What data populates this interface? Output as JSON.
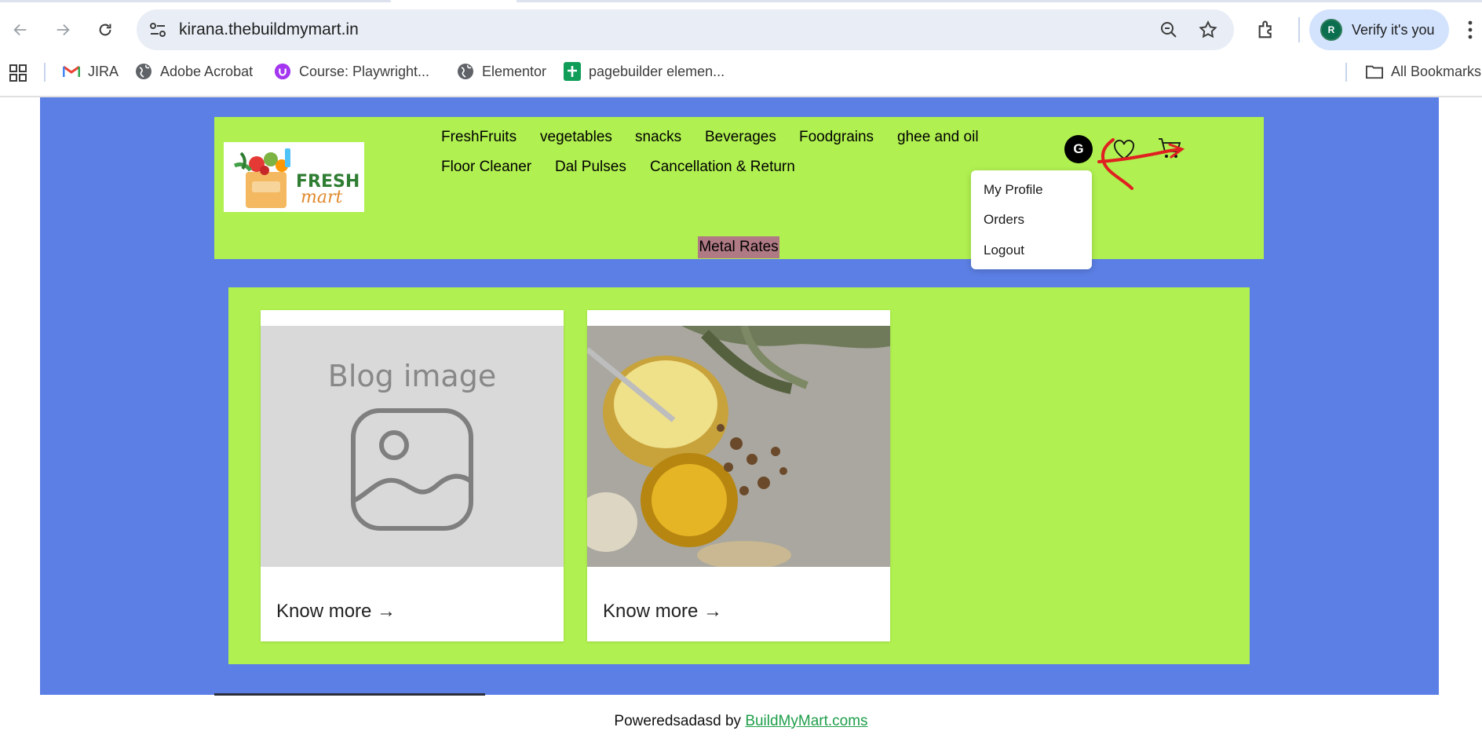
{
  "browser": {
    "url": "kirana.thebuildmymart.in",
    "verify_label": "Verify it's you",
    "profile_initial": "R",
    "bookmarks": [
      {
        "label": "JIRA",
        "icon": "gmail-icon"
      },
      {
        "label": "Adobe Acrobat",
        "icon": "globe-icon"
      },
      {
        "label": "Course: Playwright...",
        "icon": "udemy-icon"
      },
      {
        "label": "Elementor",
        "icon": "globe-icon"
      },
      {
        "label": "pagebuilder elemen...",
        "icon": "sheets-icon"
      }
    ],
    "all_bookmarks_label": "All Bookmarks"
  },
  "site": {
    "logo_text_top": "FRESH",
    "logo_text_bottom": "mart",
    "nav": [
      "FreshFruits",
      "vegetables",
      "snacks",
      "Beverages",
      "Foodgrains",
      "ghee and oil",
      "Floor Cleaner",
      "Dal Pulses",
      "Cancellation & Return"
    ],
    "metal_rates": "Metal Rates",
    "user_initial": "G",
    "dropdown": [
      "My Profile",
      "Orders",
      "Logout"
    ]
  },
  "cards": [
    {
      "placeholder_text": "Blog image",
      "link": "Know more →"
    },
    {
      "placeholder_text": "",
      "link": "Know more →"
    }
  ],
  "footer": {
    "prefix": "Poweredsadasd by ",
    "link": "BuildMyMart.coms"
  },
  "colors": {
    "page_bg": "#5b7fe4",
    "header_bg": "#b0f050",
    "metal_rates_bg": "#b07a85",
    "footer_link": "#1e9e4a",
    "annotation": "#e02020"
  }
}
